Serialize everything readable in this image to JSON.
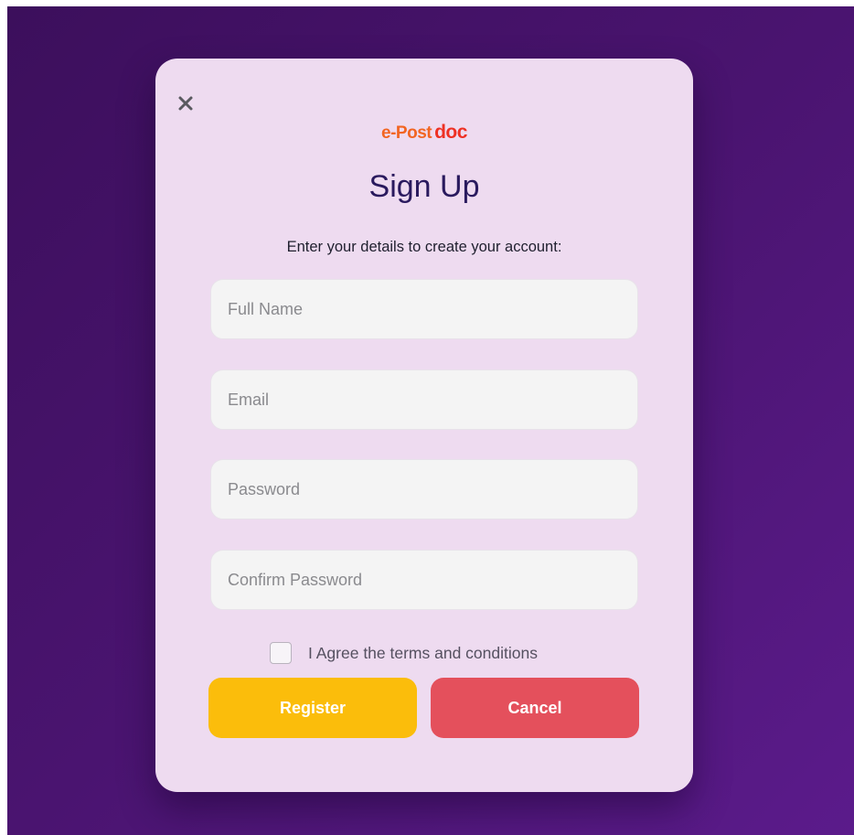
{
  "logo": {
    "part1": "e-Post",
    "part2": "doc"
  },
  "title": "Sign Up",
  "subtitle": "Enter your details to create your account:",
  "fields": [
    {
      "placeholder": "Full Name",
      "value": ""
    },
    {
      "placeholder": "Email",
      "value": ""
    },
    {
      "placeholder": "Password",
      "value": ""
    },
    {
      "placeholder": "Confirm Password",
      "value": ""
    }
  ],
  "agree": {
    "label": "I Agree the terms and conditions",
    "checked": false
  },
  "buttons": {
    "register": "Register",
    "cancel": "Cancel"
  },
  "icons": {
    "close": "close-icon"
  },
  "colors": {
    "background": "#4a1470",
    "modal": "#eedbf0",
    "title": "#2a1a5e",
    "register": "#fbbd0b",
    "cancel": "#e4505c"
  }
}
